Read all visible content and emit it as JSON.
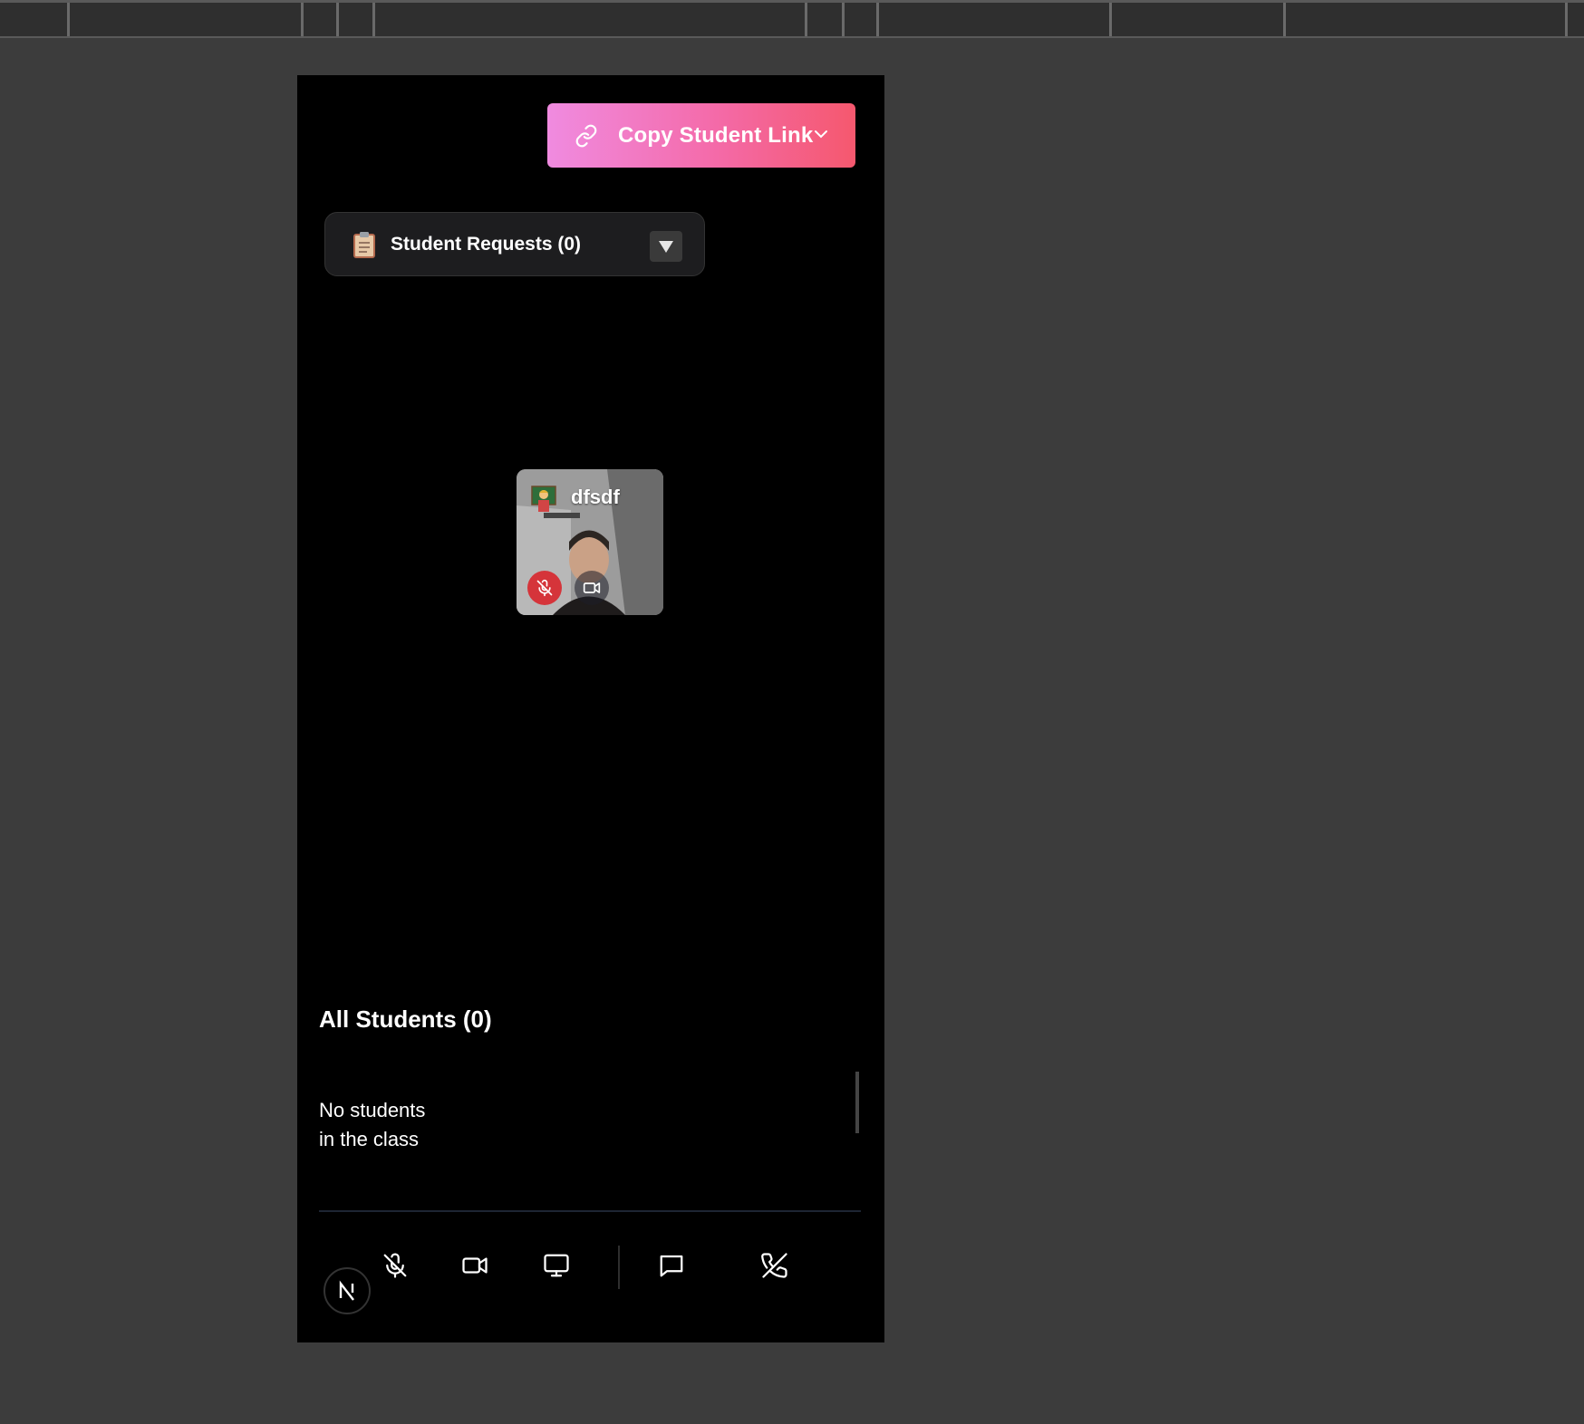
{
  "copy_button": {
    "label": "Copy Student Link",
    "icon": "link-icon",
    "chevron": "chevron-down-icon"
  },
  "requests": {
    "label": "Student Requests (0)",
    "icon": "clipboard-icon",
    "dropdown_icon": "triangle-down-icon"
  },
  "participant": {
    "name": "dfsdf",
    "icon": "teacher-emoji-icon",
    "mic_state": "muted",
    "camera_state": "on"
  },
  "students": {
    "title": "All Students (0)",
    "empty_text": "No students in the class"
  },
  "controls": [
    {
      "name": "mute-mic",
      "icon": "mic-off-icon"
    },
    {
      "name": "camera",
      "icon": "video-icon"
    },
    {
      "name": "screen-share",
      "icon": "monitor-icon"
    },
    {
      "name": "chat",
      "icon": "chat-icon"
    },
    {
      "name": "end-call",
      "icon": "phone-off-icon"
    }
  ],
  "badge": {
    "letter": "N"
  },
  "colors": {
    "background": "#3c3c3c",
    "frame": "#000000",
    "gradient_start": "#f08be0",
    "gradient_end": "#f5586e",
    "mic_muted": "#d5343a"
  }
}
